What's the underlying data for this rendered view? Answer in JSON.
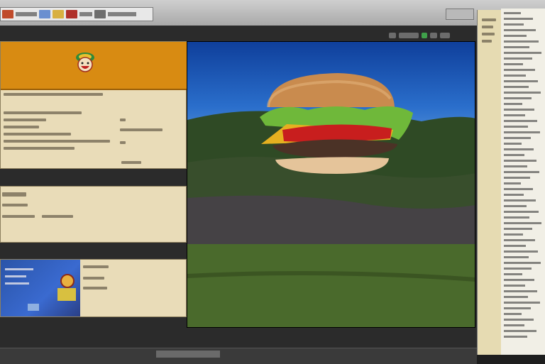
{
  "top": {
    "tab_colors": [
      "#c04b2b",
      "#6a8fd0",
      "#d8b040",
      "#b0302a",
      "#6e6e6e"
    ]
  },
  "colors": {
    "card_fill": "#e9dcb8",
    "header_orange": "#d88b12",
    "sky_blue": "#1a4fb0",
    "hill_green": "#3d5a2a"
  },
  "icons": {
    "logo": "mascot-logo-icon",
    "burger": "burger-image",
    "toolbar": [
      "zoom-icon",
      "color-icon",
      "settings-icon"
    ]
  }
}
